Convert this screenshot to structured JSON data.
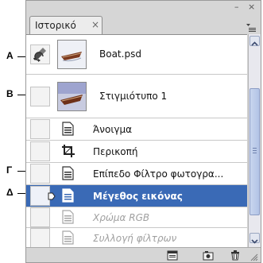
{
  "callouts": [
    "A",
    "B",
    "Γ",
    "Δ"
  ],
  "panel": {
    "tab_label": "Ιστορικό",
    "tab_close": "×",
    "minimize": "–",
    "close": "×"
  },
  "history": {
    "snapshots": [
      {
        "label": "Boat.psd",
        "source_icon": "history-brush-icon"
      },
      {
        "label": "Στιγμιότυπο 1"
      }
    ],
    "states": [
      {
        "label": "Άνοιγμα",
        "icon": "document-icon",
        "state": "normal"
      },
      {
        "label": "Περικοπή",
        "icon": "crop-icon",
        "state": "normal"
      },
      {
        "label": "Επίπεδο Φίλτρο φωτογρα...",
        "icon": "document-icon",
        "state": "normal"
      },
      {
        "label": "Μέγεθος εικόνας",
        "icon": "document-icon",
        "state": "selected"
      },
      {
        "label": "Χρώμα RGB",
        "icon": "document-icon",
        "state": "dimmed"
      },
      {
        "label": "Συλλογή φίλτρων",
        "icon": "document-icon",
        "state": "dimmed"
      }
    ]
  },
  "toolbar": {
    "icons": [
      "new-document-from-state-icon",
      "new-snapshot-icon",
      "delete-state-icon"
    ]
  },
  "colors": {
    "selected_row": "#3a6ab6",
    "panel_bg": "#d6d6d6",
    "dimmed_text": "#a0a0a0"
  }
}
